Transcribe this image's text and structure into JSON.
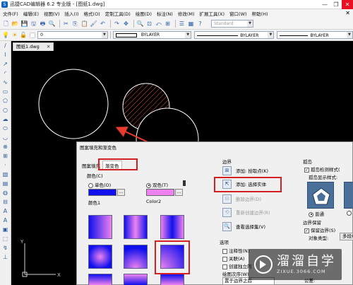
{
  "app": {
    "title": "迅捷CAD编辑器 6.2 专业版 - [图纸1.dwg]",
    "logo_glyph": "S",
    "window_buttons": [
      "—",
      "❐",
      "✕"
    ]
  },
  "menu": {
    "items": [
      "文件(F)",
      "编辑(E)",
      "视图(V)",
      "插入(I)",
      "格式(O)",
      "定制工具(D)",
      "绘图(D)",
      "标注(N)",
      "修改(M)",
      "扩展工具(X)",
      "窗口(W)",
      "帮助(H)"
    ],
    "close_glyph": "✕"
  },
  "toolbar1": {
    "text_style": "Standard",
    "icons": [
      "new-file-icon",
      "open-folder-icon",
      "save-icon",
      "save-as-icon",
      "print-icon",
      "print-preview-icon",
      "cut-icon",
      "copy-icon",
      "paste-icon",
      "match-properties-icon",
      "undo-icon",
      "redo-icon",
      "pan-icon",
      "zoom-realtime-icon",
      "zoom-window-icon",
      "zoom-previous-icon",
      "zoom-extents-icon",
      "properties-icon",
      "design-center-icon",
      "help-icon"
    ],
    "glyphs": [
      "🗋",
      "📂",
      "💾",
      "🖫",
      "🖶",
      "🔍",
      "✂",
      "⎘",
      "📋",
      "🖌",
      "↶",
      "↷",
      "✥",
      "🔍",
      "⊡",
      "⤺",
      "⊞",
      "☰",
      "▦",
      "?"
    ]
  },
  "toolbar2": {
    "layer_value": "0",
    "color_value": "BYLAYER",
    "linetype_value": "BYLAYER",
    "lineweight_value": "BYLAYER",
    "layer_glyphs": [
      "💡",
      "☀",
      "🔓",
      "■"
    ]
  },
  "left_toolbar": {
    "icons": [
      "line-icon",
      "polyline-icon",
      "construction-line-icon",
      "arc-icon",
      "spline-icon",
      "rectangle-icon",
      "polygon-icon",
      "circle-icon",
      "revision-cloud-icon",
      "ellipse-icon",
      "ellipse-arc-icon",
      "block-insert-icon",
      "make-block-icon",
      "point-icon",
      "hatch-icon",
      "gradient-icon",
      "region-icon",
      "table-icon",
      "text-icon",
      "mtext-icon",
      "insert-image-icon",
      "wipeout-icon",
      "axis-icon",
      "ucs-icon"
    ],
    "glyphs": [
      "/",
      "⌇",
      "↗",
      "◜",
      "∿",
      "▭",
      "⬠",
      "○",
      "☁",
      "⬭",
      "◡",
      "⊕",
      "⊞",
      "·",
      "▧",
      "▤",
      "◍",
      "⊟",
      "A",
      "A",
      "▣",
      "⬚",
      "↯",
      "⊥"
    ]
  },
  "document_tab": {
    "label": "图纸1.dwg",
    "close_glyph": "✕"
  },
  "dialog": {
    "title": "图案填充和渐变色",
    "tabs": [
      "图案填充",
      "渐变色"
    ],
    "color_section": "颜色(C)",
    "single_color_label": "单色(O)",
    "dual_color_label": "双色(T)",
    "color1_caption": "颜色1",
    "color2_caption": "Color2",
    "color1_hex": "#1010ee",
    "color2_hex": "#ee82ee",
    "color_mode": "dual",
    "more_glyph": "…",
    "selected_gradient": "spherical",
    "gradient_patterns": [
      "linear",
      "cylinder",
      "inv-cylinder",
      "spherical",
      "hemispherical",
      "curved",
      "inv-spherical",
      "inv-hemispherical",
      "inv-curved"
    ],
    "boundary": {
      "title": "边界",
      "add_pick_points": "添加: 拾取点(K)",
      "add_select_objects": "添加: 选择实体",
      "remove_boundaries": "删除边界(D)",
      "recreate_boundary": "重新创建边界(R)",
      "view_selections": "查看选择集(V)"
    },
    "options": {
      "title": "选项",
      "annotative": "注释性(N)",
      "associative": "关联(A)",
      "create_separate": "创建独立的",
      "draw_order_label": "绘图次序(W)",
      "draw_order_value": "置于边界之后"
    },
    "islands": {
      "title": "孤岛",
      "island_detection": "孤岛检测样式(",
      "island_display": "孤岛显示样式:",
      "normal_label": "普通"
    },
    "boundary_retention": {
      "title": "边界保留",
      "retain_boundaries": "保留边界(S)",
      "object_type_label": "对象类型:",
      "object_type_value": "多段线"
    },
    "tolerance_label": "公差:"
  },
  "watermark": {
    "title": "溜溜自学",
    "url": "ZIXUE.3066.COM"
  }
}
